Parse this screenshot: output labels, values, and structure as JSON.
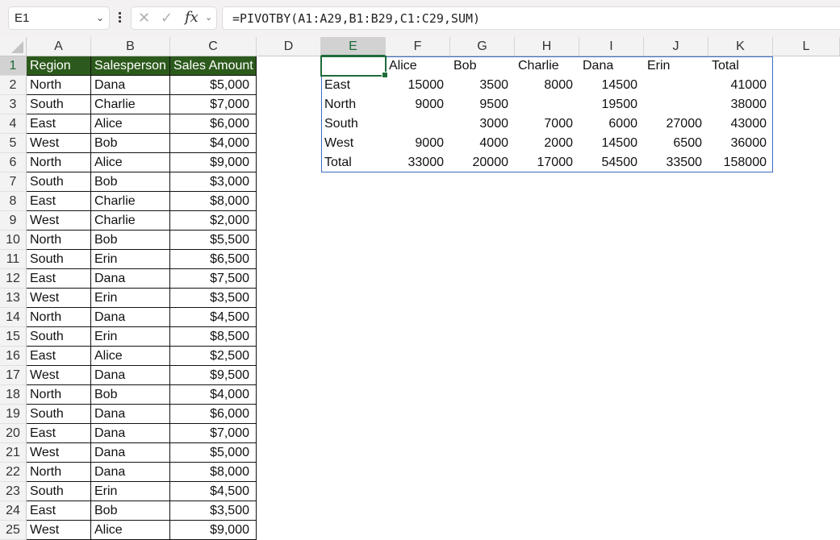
{
  "name_box": {
    "value": "E1"
  },
  "formula_bar": {
    "value": "=PIVOTBY(A1:A29,B1:B29,C1:C29,SUM)",
    "cancel_icon": "x-icon",
    "enter_icon": "check-icon",
    "fx_label": "fx"
  },
  "columns": [
    "A",
    "B",
    "C",
    "D",
    "E",
    "F",
    "G",
    "H",
    "I",
    "J",
    "K",
    "L"
  ],
  "selected_column": "E",
  "selected_row": "1",
  "rows": [
    "1",
    "2",
    "3",
    "4",
    "5",
    "6",
    "7",
    "8",
    "9",
    "10",
    "11",
    "12",
    "13",
    "14",
    "15",
    "16",
    "17",
    "18",
    "19",
    "20",
    "21",
    "22",
    "23",
    "24",
    "25"
  ],
  "source_table": {
    "headers": [
      "Region",
      "Salesperson",
      "Sales Amount"
    ],
    "header_color": "#2c5a1c",
    "data": [
      [
        "North",
        "Dana",
        "$5,000"
      ],
      [
        "South",
        "Charlie",
        "$7,000"
      ],
      [
        "East",
        "Alice",
        "$6,000"
      ],
      [
        "West",
        "Bob",
        "$4,000"
      ],
      [
        "North",
        "Alice",
        "$9,000"
      ],
      [
        "South",
        "Bob",
        "$3,000"
      ],
      [
        "East",
        "Charlie",
        "$8,000"
      ],
      [
        "West",
        "Charlie",
        "$2,000"
      ],
      [
        "North",
        "Bob",
        "$5,500"
      ],
      [
        "South",
        "Erin",
        "$6,500"
      ],
      [
        "East",
        "Dana",
        "$7,500"
      ],
      [
        "West",
        "Erin",
        "$3,500"
      ],
      [
        "North",
        "Dana",
        "$4,500"
      ],
      [
        "South",
        "Erin",
        "$8,500"
      ],
      [
        "East",
        "Alice",
        "$2,500"
      ],
      [
        "West",
        "Dana",
        "$9,500"
      ],
      [
        "North",
        "Bob",
        "$4,000"
      ],
      [
        "South",
        "Dana",
        "$6,000"
      ],
      [
        "East",
        "Dana",
        "$7,000"
      ],
      [
        "West",
        "Dana",
        "$5,000"
      ],
      [
        "North",
        "Dana",
        "$8,000"
      ],
      [
        "South",
        "Erin",
        "$4,500"
      ],
      [
        "East",
        "Bob",
        "$3,500"
      ],
      [
        "West",
        "Alice",
        "$9,000"
      ]
    ]
  },
  "pivot": {
    "headers": [
      "",
      "Alice",
      "Bob",
      "Charlie",
      "Dana",
      "Erin",
      "Total"
    ],
    "rows": [
      [
        "East",
        "15000",
        "3500",
        "8000",
        "14500",
        "",
        "41000"
      ],
      [
        "North",
        "9000",
        "9500",
        "",
        "19500",
        "",
        "38000"
      ],
      [
        "South",
        "",
        "3000",
        "7000",
        "6000",
        "27000",
        "43000"
      ],
      [
        "West",
        "9000",
        "4000",
        "2000",
        "14500",
        "6500",
        "36000"
      ],
      [
        "Total",
        "33000",
        "20000",
        "17000",
        "54500",
        "33500",
        "158000"
      ]
    ]
  }
}
